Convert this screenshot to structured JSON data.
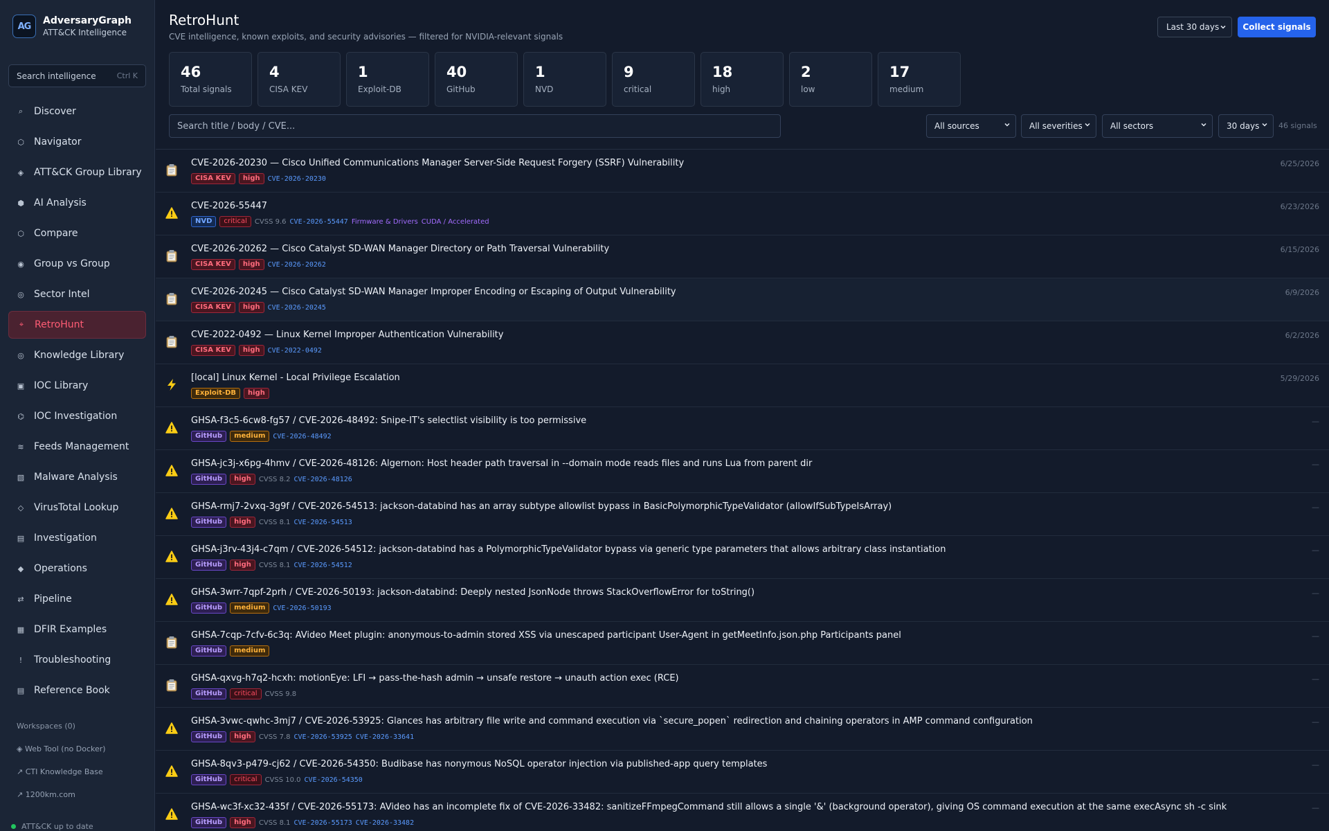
{
  "sidebar": {
    "brand_name": "AdversaryGraph",
    "brand_sub": "ATT&CK Intelligence",
    "logo_text": "AG",
    "search_placeholder": "Search intelligence",
    "search_shortcut": "Ctrl K",
    "nav": [
      {
        "label": "Discover",
        "icon": "search-icon",
        "glyph": "⌕"
      },
      {
        "label": "Navigator",
        "icon": "hexagon-icon",
        "glyph": "⬡"
      },
      {
        "label": "ATT&CK Group Library",
        "icon": "diamond-icon",
        "glyph": "◈"
      },
      {
        "label": "AI Analysis",
        "icon": "hexagon-filled-icon",
        "glyph": "⬢"
      },
      {
        "label": "Compare",
        "icon": "hexagon-icon",
        "glyph": "⬡"
      },
      {
        "label": "Group vs Group",
        "icon": "target-icon",
        "glyph": "◉"
      },
      {
        "label": "Sector Intel",
        "icon": "ring-icon",
        "glyph": "◎"
      },
      {
        "label": "RetroHunt",
        "icon": "retrohunt-icon",
        "glyph": "⌖",
        "active": true
      },
      {
        "label": "Knowledge Library",
        "icon": "ring-icon",
        "glyph": "◎"
      },
      {
        "label": "IOC Library",
        "icon": "square-icon",
        "glyph": "▣"
      },
      {
        "label": "IOC Investigation",
        "icon": "investigate-icon",
        "glyph": "⌬"
      },
      {
        "label": "Feeds Management",
        "icon": "feed-icon",
        "glyph": "≋"
      },
      {
        "label": "Malware Analysis",
        "icon": "hatched-square-icon",
        "glyph": "▧"
      },
      {
        "label": "VirusTotal Lookup",
        "icon": "diamond-outline-icon",
        "glyph": "◇"
      },
      {
        "label": "Investigation",
        "icon": "list-icon",
        "glyph": "▤"
      },
      {
        "label": "Operations",
        "icon": "diamond-filled-icon",
        "glyph": "◆"
      },
      {
        "label": "Pipeline",
        "icon": "swap-icon",
        "glyph": "⇄"
      },
      {
        "label": "DFIR Examples",
        "icon": "grid-icon",
        "glyph": "▦"
      },
      {
        "label": "Troubleshooting",
        "icon": "exclamation-icon",
        "glyph": "!"
      },
      {
        "label": "Reference Book",
        "icon": "book-icon",
        "glyph": "▤"
      }
    ],
    "workspaces_label": "Workspaces (0)",
    "links": [
      {
        "label": "◈ Web Tool (no Docker)"
      },
      {
        "label": "↗ CTI Knowledge Base"
      },
      {
        "label": "↗ 1200km.com"
      }
    ],
    "status": "ATT&CK up to date"
  },
  "header": {
    "title": "RetroHunt",
    "subtitle": "CVE intelligence, known exploits, and security advisories — filtered for NVIDIA-relevant signals",
    "range_value": "Last 30 days",
    "collect_label": "Collect signals"
  },
  "stats": [
    {
      "value": "46",
      "label": "Total signals"
    },
    {
      "value": "4",
      "label": "CISA KEV"
    },
    {
      "value": "1",
      "label": "Exploit-DB"
    },
    {
      "value": "40",
      "label": "GitHub"
    },
    {
      "value": "1",
      "label": "NVD"
    },
    {
      "value": "9",
      "label": "critical"
    },
    {
      "value": "18",
      "label": "high"
    },
    {
      "value": "2",
      "label": "low"
    },
    {
      "value": "17",
      "label": "medium"
    }
  ],
  "filters": {
    "search_placeholder": "Search title / body / CVE...",
    "sources": "All sources",
    "severities": "All severities",
    "sectors": "All sectors",
    "days": "30 days",
    "count": "46 signals"
  },
  "rows": [
    {
      "icon": "clipboard-icon",
      "glyph": "📋",
      "title": "CVE-2026-20230 — Cisco Unified Communications Manager Server-Side Request Forgery (SSRF) Vulnerability",
      "date": "6/25/2026",
      "tags": [
        {
          "k": "tag",
          "c": "t-kev",
          "t": "CISA KEV"
        },
        {
          "k": "tag",
          "c": "t-high",
          "t": "high"
        },
        {
          "k": "cve",
          "t": "CVE-2026-20230"
        }
      ]
    },
    {
      "icon": "warning-icon",
      "glyph": "⚠",
      "title": "CVE-2026-55447",
      "date": "6/23/2026",
      "tags": [
        {
          "k": "tag",
          "c": "t-nvd",
          "t": "NVD"
        },
        {
          "k": "tag",
          "c": "t-crit",
          "t": "critical"
        },
        {
          "k": "cvss",
          "t": "CVSS 9.6"
        },
        {
          "k": "cve",
          "t": "CVE-2026-55447"
        },
        {
          "k": "extra",
          "t": "Firmware & Drivers"
        },
        {
          "k": "extra",
          "t": "CUDA / Accelerated"
        }
      ]
    },
    {
      "icon": "clipboard-icon",
      "glyph": "📋",
      "title": "CVE-2026-20262 — Cisco Catalyst SD-WAN Manager Directory or Path Traversal Vulnerability",
      "date": "6/15/2026",
      "tags": [
        {
          "k": "tag",
          "c": "t-kev",
          "t": "CISA KEV"
        },
        {
          "k": "tag",
          "c": "t-high",
          "t": "high"
        },
        {
          "k": "cve",
          "t": "CVE-2026-20262"
        }
      ]
    },
    {
      "icon": "clipboard-icon",
      "glyph": "📋",
      "title": "CVE-2026-20245 — Cisco Catalyst SD-WAN Manager Improper Encoding or Escaping of Output Vulnerability",
      "date": "6/9/2026",
      "hl": true,
      "tags": [
        {
          "k": "tag",
          "c": "t-kev",
          "t": "CISA KEV"
        },
        {
          "k": "tag",
          "c": "t-high",
          "t": "high"
        },
        {
          "k": "cve",
          "t": "CVE-2026-20245"
        }
      ]
    },
    {
      "icon": "clipboard-icon",
      "glyph": "📋",
      "title": "CVE-2022-0492 — Linux Kernel Improper Authentication Vulnerability",
      "date": "6/2/2026",
      "tags": [
        {
          "k": "tag",
          "c": "t-kev",
          "t": "CISA KEV"
        },
        {
          "k": "tag",
          "c": "t-high",
          "t": "high"
        },
        {
          "k": "cve",
          "t": "CVE-2022-0492"
        }
      ]
    },
    {
      "icon": "lightning-icon",
      "glyph": "⚡",
      "title": "[local] Linux Kernel - Local Privilege Escalation",
      "date": "5/29/2026",
      "tags": [
        {
          "k": "tag",
          "c": "t-edb",
          "t": "Exploit-DB"
        },
        {
          "k": "tag",
          "c": "t-high",
          "t": "high"
        }
      ]
    },
    {
      "icon": "warning-icon",
      "glyph": "⚠",
      "title": "GHSA-f3c5-6cw8-fg57 / CVE-2026-48492: Snipe-IT's selectlist visibility is too permissive",
      "date": "—",
      "tags": [
        {
          "k": "tag",
          "c": "t-gh",
          "t": "GitHub"
        },
        {
          "k": "tag",
          "c": "t-med",
          "t": "medium"
        },
        {
          "k": "cve",
          "t": "CVE-2026-48492"
        }
      ]
    },
    {
      "icon": "warning-icon",
      "glyph": "⚠",
      "title": "GHSA-jc3j-x6pg-4hmv / CVE-2026-48126: Algernon: Host header path traversal in --domain mode reads files and runs Lua from parent dir",
      "date": "—",
      "tags": [
        {
          "k": "tag",
          "c": "t-gh",
          "t": "GitHub"
        },
        {
          "k": "tag",
          "c": "t-high",
          "t": "high"
        },
        {
          "k": "cvss",
          "t": "CVSS 8.2"
        },
        {
          "k": "cve",
          "t": "CVE-2026-48126"
        }
      ]
    },
    {
      "icon": "warning-icon",
      "glyph": "⚠",
      "title": "GHSA-rmj7-2vxq-3g9f / CVE-2026-54513: jackson-databind has an array subtype allowlist bypass in BasicPolymorphicTypeValidator (allowIfSubTypeIsArray)",
      "date": "—",
      "tags": [
        {
          "k": "tag",
          "c": "t-gh",
          "t": "GitHub"
        },
        {
          "k": "tag",
          "c": "t-high",
          "t": "high"
        },
        {
          "k": "cvss",
          "t": "CVSS 8.1"
        },
        {
          "k": "cve",
          "t": "CVE-2026-54513"
        }
      ]
    },
    {
      "icon": "warning-icon",
      "glyph": "⚠",
      "title": "GHSA-j3rv-43j4-c7qm / CVE-2026-54512: jackson-databind has a PolymorphicTypeValidator bypass via generic type parameters that allows arbitrary class instantiation",
      "date": "—",
      "tags": [
        {
          "k": "tag",
          "c": "t-gh",
          "t": "GitHub"
        },
        {
          "k": "tag",
          "c": "t-high",
          "t": "high"
        },
        {
          "k": "cvss",
          "t": "CVSS 8.1"
        },
        {
          "k": "cve",
          "t": "CVE-2026-54512"
        }
      ]
    },
    {
      "icon": "warning-icon",
      "glyph": "⚠",
      "title": "GHSA-3wrr-7qpf-2prh / CVE-2026-50193: jackson-databind: Deeply nested JsonNode throws StackOverflowError for toString()",
      "date": "—",
      "tags": [
        {
          "k": "tag",
          "c": "t-gh",
          "t": "GitHub"
        },
        {
          "k": "tag",
          "c": "t-med",
          "t": "medium"
        },
        {
          "k": "cve",
          "t": "CVE-2026-50193"
        }
      ]
    },
    {
      "icon": "clipboard-icon",
      "glyph": "📋",
      "title": "GHSA-7cqp-7cfv-6c3q: AVideo Meet plugin: anonymous-to-admin stored XSS via unescaped participant User-Agent in getMeetInfo.json.php Participants panel",
      "date": "—",
      "tags": [
        {
          "k": "tag",
          "c": "t-gh",
          "t": "GitHub"
        },
        {
          "k": "tag",
          "c": "t-med",
          "t": "medium"
        }
      ]
    },
    {
      "icon": "clipboard-icon",
      "glyph": "📋",
      "title": "GHSA-qxvg-h7q2-hcxh: motionEye: LFI → pass-the-hash admin → unsafe restore → unauth action exec (RCE)",
      "date": "—",
      "tags": [
        {
          "k": "tag",
          "c": "t-gh",
          "t": "GitHub"
        },
        {
          "k": "tag",
          "c": "t-crit",
          "t": "critical"
        },
        {
          "k": "cvss",
          "t": "CVSS 9.8"
        }
      ]
    },
    {
      "icon": "warning-icon",
      "glyph": "⚠",
      "title": "GHSA-3vwc-qwhc-3mj7 / CVE-2026-53925: Glances has arbitrary file write and command execution via `secure_popen` redirection and chaining operators in AMP command configuration",
      "date": "—",
      "tags": [
        {
          "k": "tag",
          "c": "t-gh",
          "t": "GitHub"
        },
        {
          "k": "tag",
          "c": "t-high",
          "t": "high"
        },
        {
          "k": "cvss",
          "t": "CVSS 7.8"
        },
        {
          "k": "cve",
          "t": "CVE-2026-53925"
        },
        {
          "k": "cve",
          "t": "CVE-2026-33641"
        }
      ]
    },
    {
      "icon": "warning-icon",
      "glyph": "⚠",
      "title": "GHSA-8qv3-p479-cj62 / CVE-2026-54350: Budibase has nonymous NoSQL operator injection via published-app query templates",
      "date": "—",
      "tags": [
        {
          "k": "tag",
          "c": "t-gh",
          "t": "GitHub"
        },
        {
          "k": "tag",
          "c": "t-crit",
          "t": "critical"
        },
        {
          "k": "cvss",
          "t": "CVSS 10.0"
        },
        {
          "k": "cve",
          "t": "CVE-2026-54350"
        }
      ]
    },
    {
      "icon": "warning-icon",
      "glyph": "⚠",
      "title": "GHSA-wc3f-xc32-435f / CVE-2026-55173: AVideo has an incomplete fix of CVE-2026-33482: sanitizeFFmpegCommand still allows a single '&' (background operator), giving OS command execution at the same execAsync sh -c sink",
      "date": "—",
      "tags": [
        {
          "k": "tag",
          "c": "t-gh",
          "t": "GitHub"
        },
        {
          "k": "tag",
          "c": "t-high",
          "t": "high"
        },
        {
          "k": "cvss",
          "t": "CVSS 8.1"
        },
        {
          "k": "cve",
          "t": "CVE-2026-55173"
        },
        {
          "k": "cve",
          "t": "CVE-2026-33482"
        }
      ]
    }
  ],
  "colors": {
    "accent": "#2563eb",
    "active_nav": "#ff5c74",
    "warning": "#facc15",
    "critical": "#ff4d62"
  }
}
